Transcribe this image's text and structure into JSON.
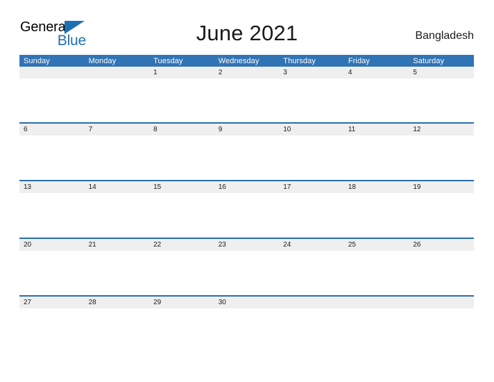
{
  "brand": {
    "name_part1": "General",
    "name_part2": "Blue",
    "flag_icon": "blue-triangle-flag-icon",
    "color_primary": "#1f6fb4"
  },
  "header": {
    "title": "June 2021",
    "locale": "Bangladesh"
  },
  "calendar": {
    "month": "June",
    "year": "2021",
    "header_bg": "#3174b5",
    "daynum_band_bg": "#efefef",
    "row_border_color": "#2b6cae",
    "day_names": [
      "Sunday",
      "Monday",
      "Tuesday",
      "Wednesday",
      "Thursday",
      "Friday",
      "Saturday"
    ],
    "weeks": [
      {
        "days": [
          {
            "num": ""
          },
          {
            "num": ""
          },
          {
            "num": "1"
          },
          {
            "num": "2"
          },
          {
            "num": "3"
          },
          {
            "num": "4"
          },
          {
            "num": "5"
          }
        ]
      },
      {
        "days": [
          {
            "num": "6"
          },
          {
            "num": "7"
          },
          {
            "num": "8"
          },
          {
            "num": "9"
          },
          {
            "num": "10"
          },
          {
            "num": "11"
          },
          {
            "num": "12"
          }
        ]
      },
      {
        "days": [
          {
            "num": "13"
          },
          {
            "num": "14"
          },
          {
            "num": "15"
          },
          {
            "num": "16"
          },
          {
            "num": "17"
          },
          {
            "num": "18"
          },
          {
            "num": "19"
          }
        ]
      },
      {
        "days": [
          {
            "num": "20"
          },
          {
            "num": "21"
          },
          {
            "num": "22"
          },
          {
            "num": "23"
          },
          {
            "num": "24"
          },
          {
            "num": "25"
          },
          {
            "num": "26"
          }
        ]
      },
      {
        "days": [
          {
            "num": "27"
          },
          {
            "num": "28"
          },
          {
            "num": "29"
          },
          {
            "num": "30"
          },
          {
            "num": ""
          },
          {
            "num": ""
          },
          {
            "num": ""
          }
        ]
      }
    ]
  }
}
